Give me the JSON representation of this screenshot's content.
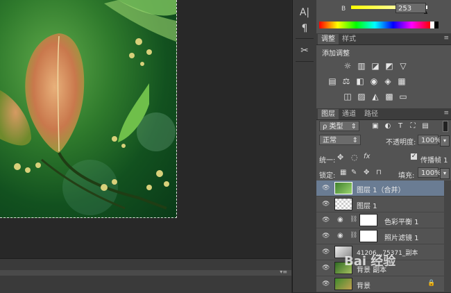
{
  "tools": {
    "char_glyph": "A|",
    "para_glyph": "¶",
    "misc_glyph": "✂"
  },
  "color_panel": {
    "channel_label": "B",
    "channel_value": "253",
    "slider_fraction": 0.99
  },
  "adjustments_panel": {
    "tabs": [
      "调整",
      "样式"
    ],
    "heading": "添加调整"
  },
  "layers_panel": {
    "tabs": [
      "图层",
      "通道",
      "路径"
    ],
    "filter_label": "ρ 类型",
    "blend_mode": "正常",
    "opacity_label": "不透明度:",
    "opacity_value": "100%",
    "unify_label": "统一:",
    "propagate_label": "传播帧 1",
    "lock_label": "锁定:",
    "fill_label": "填充:",
    "fill_value": "100%",
    "layers": [
      {
        "name": "图层 1（合并）",
        "selected": true
      },
      {
        "name": "图层 1",
        "selected": false
      },
      {
        "name": "色彩平衡 1",
        "selected": false
      },
      {
        "name": "照片滤镜 1",
        "selected": false
      },
      {
        "name": "41206...75371_副本",
        "selected": false
      },
      {
        "name": "背景 副本",
        "selected": false
      },
      {
        "name": "背景",
        "selected": false
      }
    ]
  },
  "watermark": "Bai 经验",
  "colors": {
    "selected_row": "#6a7c93",
    "panel_bg": "#535353",
    "canvas_bg": "#282828"
  }
}
